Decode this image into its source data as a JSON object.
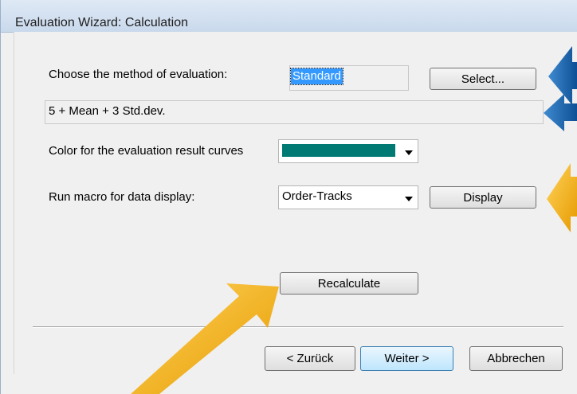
{
  "window": {
    "title": "Evaluation Wizard: Calculation"
  },
  "method": {
    "label": "Choose the method of evaluation:",
    "value": "Standard",
    "select_label": "Select...",
    "formula": "5 + Mean + 3 Std.dev."
  },
  "color": {
    "label": "Color for the evaluation result curves",
    "value": "#007a73"
  },
  "macro": {
    "label": "Run macro for data display:",
    "value": "Order-Tracks",
    "display_label": "Display"
  },
  "recalculate_label": "Recalculate",
  "nav": {
    "back_label": "< Zurück",
    "next_label": "Weiter >",
    "cancel_label": "Abbrechen"
  },
  "annotation_colors": {
    "blue": "#1565b4",
    "orange": "#f5b21c"
  }
}
